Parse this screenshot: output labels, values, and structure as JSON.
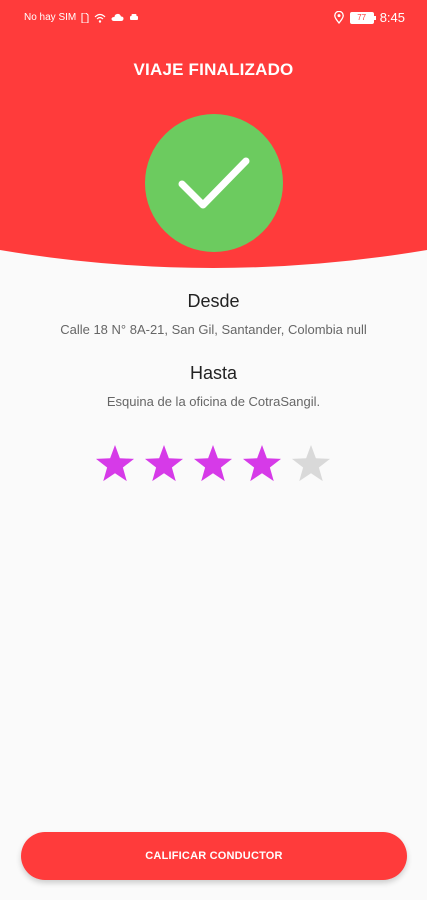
{
  "status_bar": {
    "carrier": "No hay SIM",
    "battery": "77",
    "time": "8:45",
    "icons": [
      "sim-icon",
      "wifi-icon",
      "cloud-icon",
      "car-icon",
      "location-icon",
      "battery-icon"
    ]
  },
  "header": {
    "title": "VIAJE FINALIZADO",
    "background_color": "#ff3b3b",
    "check_icon": "check-icon",
    "check_circle_color": "#6ccb5f"
  },
  "trip": {
    "from_label": "Desde",
    "from_address": "Calle 18 N° 8A-21, San Gil, Santander, Colombia null",
    "to_label": "Hasta",
    "to_address": "Esquina de la oficina de CotraSangil."
  },
  "rating": {
    "value": 4,
    "max": 5,
    "active_color": "#d63ae8",
    "inactive_color": "#d9d9d9"
  },
  "actions": {
    "rate_driver_label": "CALIFICAR CONDUCTOR"
  }
}
